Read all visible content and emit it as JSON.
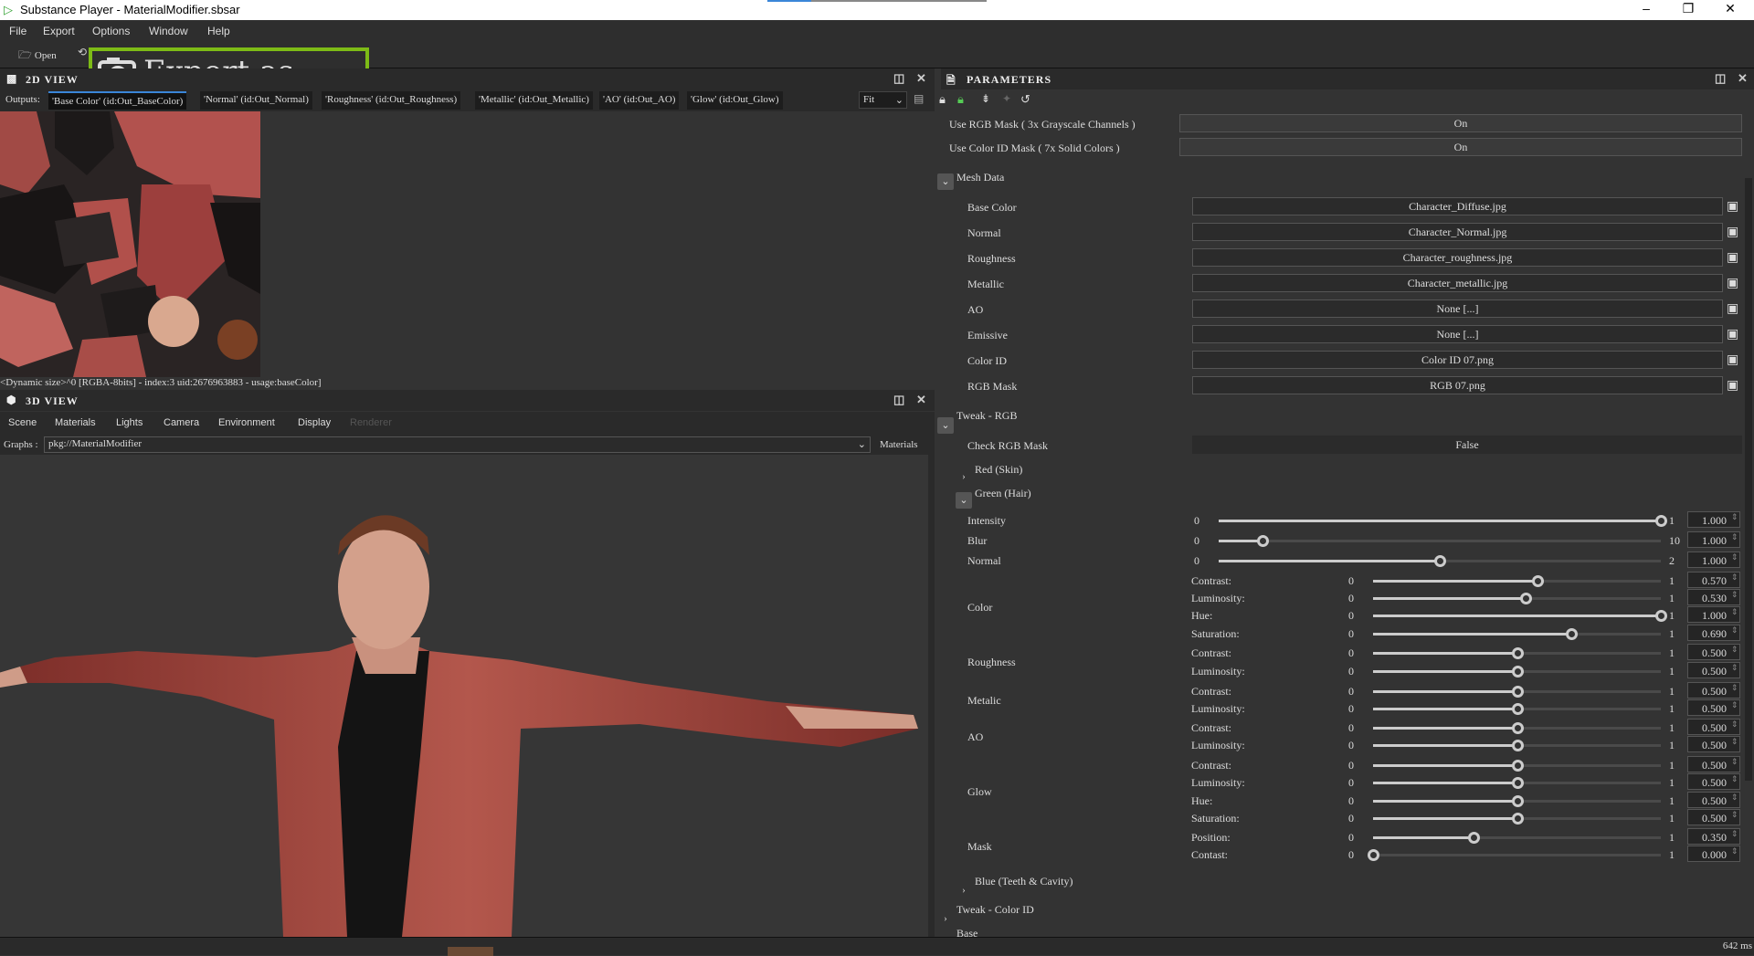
{
  "window": {
    "title": "Substance Player - MaterialModifier.sbsar",
    "minimize": "–",
    "maximize": "❐",
    "close": "✕"
  },
  "menu": [
    "File",
    "Export",
    "Options",
    "Window",
    "Help"
  ],
  "toolbar": {
    "open_label": "Open",
    "highlight_label": "Export as Bitmap"
  },
  "view2d": {
    "title": "2D VIEW",
    "outputs_label": "Outputs:",
    "outputs": [
      "'Base Color' (id:Out_BaseColor)",
      "'Normal' (id:Out_Normal)",
      "'Roughness' (id:Out_Roughness)",
      "'Metallic' (id:Out_Metallic)",
      "'AO' (id:Out_AO)",
      "'Glow' (id:Out_Glow)"
    ],
    "selected_output": 0,
    "zoom": "Fit",
    "status": "<Dynamic size>^0 [RGBA-8bits] - index:3 uid:2676963883 - usage:baseColor]"
  },
  "view3d": {
    "title": "3D VIEW",
    "tabs": [
      "Scene",
      "Materials",
      "Lights",
      "Camera",
      "Environment",
      "Display",
      "Renderer"
    ],
    "graphs_label": "Graphs :",
    "graph": "pkg://MaterialModifier",
    "materials_label": "Materials"
  },
  "parameters": {
    "title": "PARAMETERS",
    "toggles": [
      {
        "label": "Use RGB Mask ( 3x Grayscale Channels )",
        "value": "On"
      },
      {
        "label": "Use Color ID Mask ( 7x Solid Colors )",
        "value": "On"
      }
    ],
    "mesh_data": {
      "label": "Mesh Data",
      "items": [
        {
          "label": "Base Color",
          "value": "Character_Diffuse.jpg"
        },
        {
          "label": "Normal",
          "value": "Character_Normal.jpg"
        },
        {
          "label": "Roughness",
          "value": "Character_roughness.jpg"
        },
        {
          "label": "Metallic",
          "value": "Character_metallic.jpg"
        },
        {
          "label": "AO",
          "value": "None [...]"
        },
        {
          "label": "Emissive",
          "value": "None [...]"
        },
        {
          "label": "Color ID",
          "value": "Color ID 07.png"
        },
        {
          "label": "RGB Mask",
          "value": "RGB 07.png"
        }
      ]
    },
    "tweak_rgb": {
      "label": "Tweak - RGB",
      "check_label": "Check RGB Mask",
      "check_value": "False",
      "red": "Red (Skin)",
      "green": "Green (Hair)",
      "blue": "Blue (Teeth & Cavity)",
      "main_sliders": [
        {
          "label": "Intensity",
          "min": "0",
          "max": "1",
          "value": "1.000"
        },
        {
          "label": "Blur",
          "min": "0",
          "max": "10",
          "value": "1.000"
        },
        {
          "label": "Normal",
          "min": "0",
          "max": "2",
          "value": "1.000"
        }
      ],
      "groups": [
        {
          "label": "Color",
          "sliders": [
            {
              "label": "Contrast:",
              "min": "0",
              "max": "1",
              "value": "0.570"
            },
            {
              "label": "Luminosity:",
              "min": "0",
              "max": "1",
              "value": "0.530"
            },
            {
              "label": "Hue:",
              "min": "0",
              "max": "1",
              "value": "1.000"
            },
            {
              "label": "Saturation:",
              "min": "0",
              "max": "1",
              "value": "0.690"
            }
          ]
        },
        {
          "label": "Roughness",
          "sliders": [
            {
              "label": "Contrast:",
              "min": "0",
              "max": "1",
              "value": "0.500"
            },
            {
              "label": "Luminosity:",
              "min": "0",
              "max": "1",
              "value": "0.500"
            }
          ]
        },
        {
          "label": "Metalic",
          "sliders": [
            {
              "label": "Contrast:",
              "min": "0",
              "max": "1",
              "value": "0.500"
            },
            {
              "label": "Luminosity:",
              "min": "0",
              "max": "1",
              "value": "0.500"
            }
          ]
        },
        {
          "label": "AO",
          "sliders": [
            {
              "label": "Contrast:",
              "min": "0",
              "max": "1",
              "value": "0.500"
            },
            {
              "label": "Luminosity:",
              "min": "0",
              "max": "1",
              "value": "0.500"
            }
          ]
        },
        {
          "label": "Glow",
          "sliders": [
            {
              "label": "Contrast:",
              "min": "0",
              "max": "1",
              "value": "0.500"
            },
            {
              "label": "Luminosity:",
              "min": "0",
              "max": "1",
              "value": "0.500"
            },
            {
              "label": "Hue:",
              "min": "0",
              "max": "1",
              "value": "0.500"
            },
            {
              "label": "Saturation:",
              "min": "0",
              "max": "1",
              "value": "0.500"
            }
          ]
        },
        {
          "label": "Mask",
          "sliders": [
            {
              "label": "Position:",
              "min": "0",
              "max": "1",
              "value": "0.350"
            },
            {
              "label": "Contast:",
              "min": "0",
              "max": "1",
              "value": "0.000"
            }
          ]
        }
      ]
    },
    "tweak_color_id": "Tweak - Color ID",
    "base": "Base"
  },
  "status": {
    "time": "642 ms"
  },
  "colors": {
    "highlight": "#7dbb16",
    "accent": "#3a86d8",
    "jacket": "#a0463c"
  }
}
